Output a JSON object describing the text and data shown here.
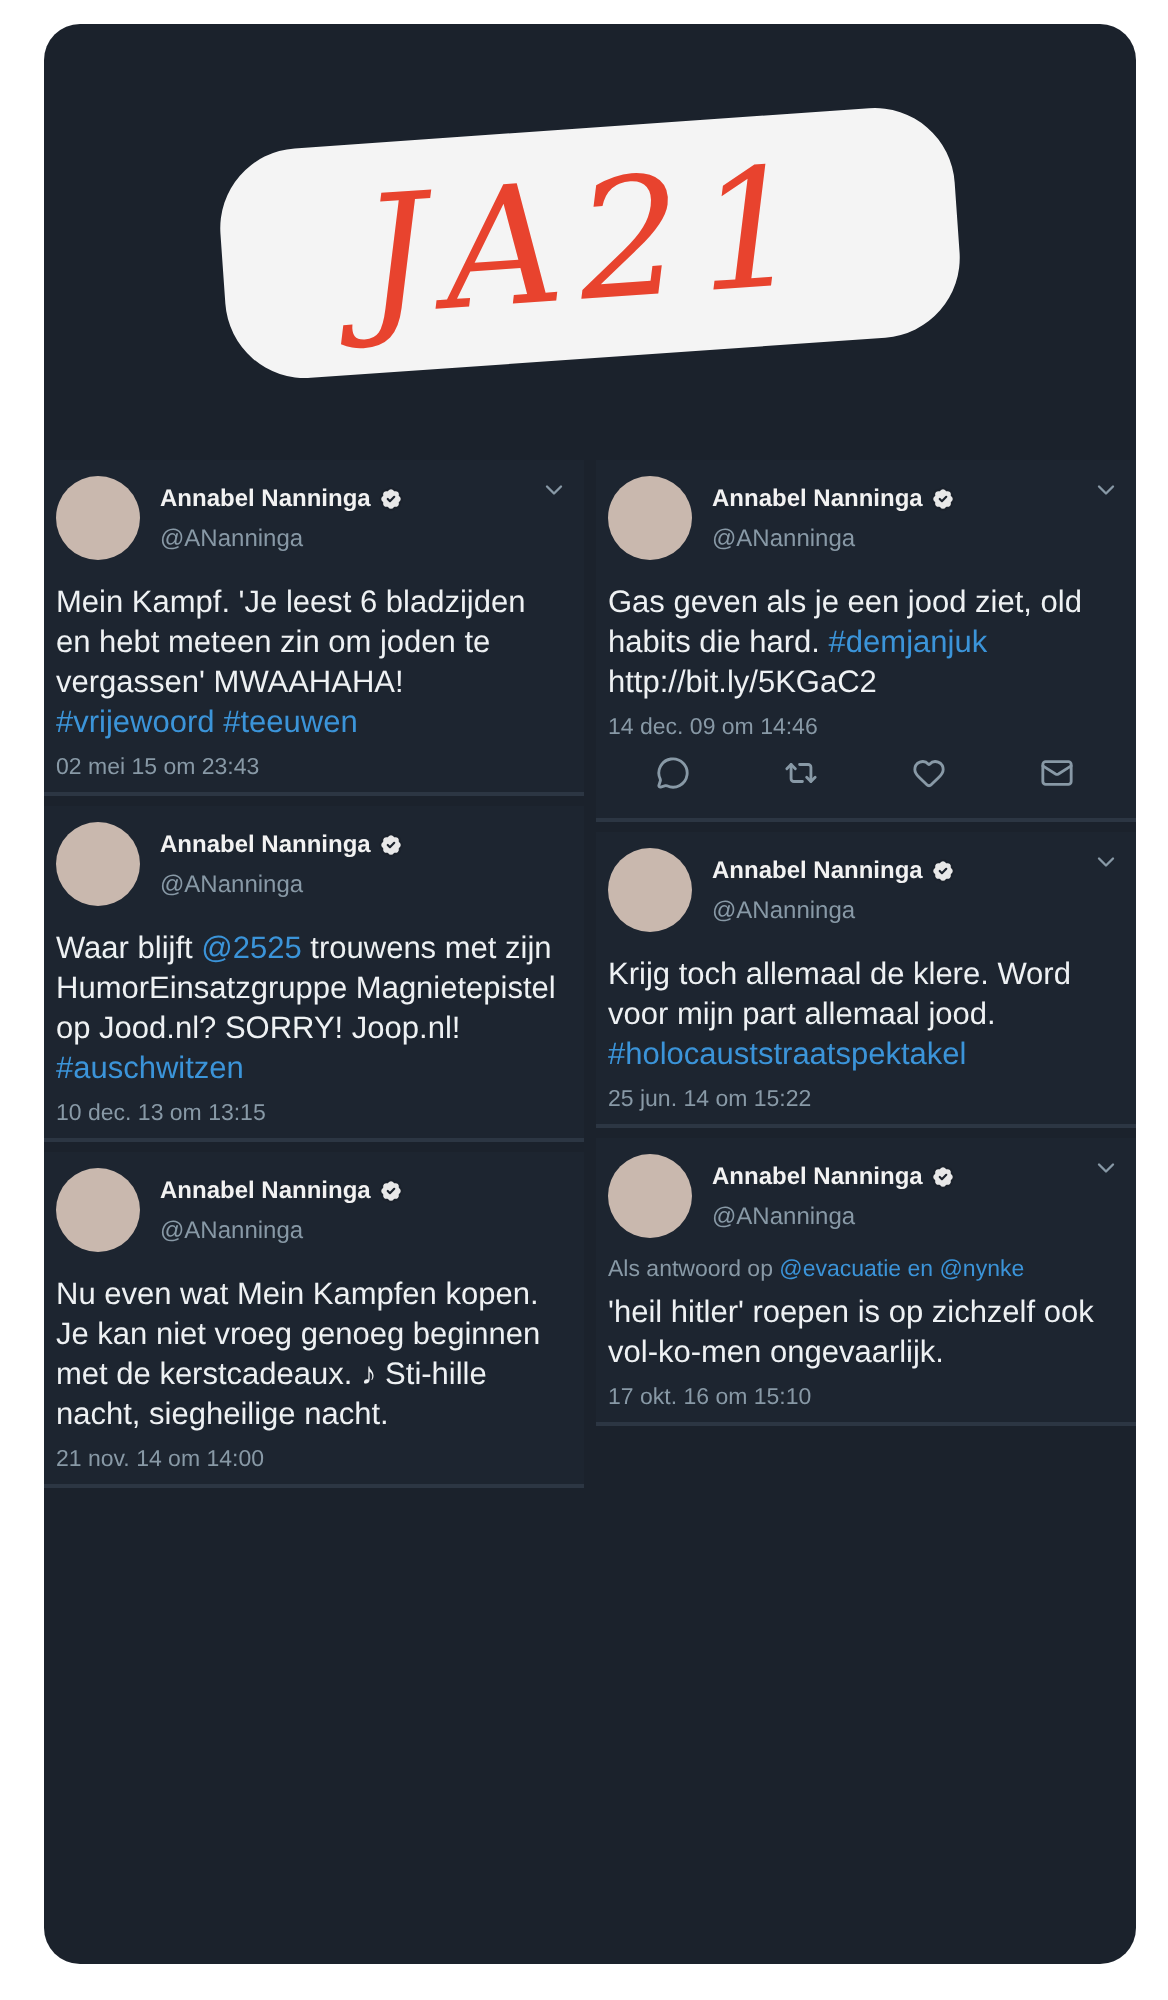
{
  "scribble": {
    "text": "JA21"
  },
  "columns": [
    {
      "tweets": [
        {
          "name": "Annabel Nanninga",
          "handle": "@ANanninga",
          "caret": true,
          "body": [
            {
              "kind": "text",
              "text": "Mein Kampf. 'Je leest 6 bladzijden en hebt meteen zin om joden te vergassen' MWAAHAHA! "
            },
            {
              "kind": "link",
              "text": "#vrijewoord"
            },
            {
              "kind": "link",
              "text": "#teeuwen"
            }
          ],
          "time": "02 mei 15 om 23:43"
        },
        {
          "name": "Annabel Nanninga",
          "handle": "@ANanninga",
          "caret": false,
          "body": [
            {
              "kind": "text",
              "text": "Waar blijft "
            },
            {
              "kind": "link",
              "text": "@2525"
            },
            {
              "kind": "text",
              "text": " trouwens met zijn HumorEinsatzgruppe Magnietepistel op Jood.nl? SORRY! Joop.nl! "
            },
            {
              "kind": "link",
              "text": "#auschwitzen"
            }
          ],
          "time": "10 dec. 13 om 13:15"
        },
        {
          "name": "Annabel Nanninga",
          "handle": "@ANanninga",
          "caret": false,
          "body": [
            {
              "kind": "text",
              "text": "Nu even wat Mein Kampfen kopen. Je kan niet vroeg genoeg beginnen met de kerstcadeaux. ♪ Sti-hille nacht, siegheilige nacht."
            }
          ],
          "time": "21 nov. 14 om 14:00"
        }
      ]
    },
    {
      "tweets": [
        {
          "name": "Annabel Nanninga",
          "handle": "@ANanninga",
          "caret": true,
          "body": [
            {
              "kind": "text",
              "text": "Gas geven als je een jood ziet, old habits die hard. "
            },
            {
              "kind": "link",
              "text": "#demjanjuk"
            },
            {
              "kind": "text",
              "text": " http://bit.ly/5KGaC2"
            }
          ],
          "time": "14 dec. 09 om 14:46",
          "action_bar": true
        },
        {
          "name": "Annabel Nanninga",
          "handle": "@ANanninga",
          "caret": true,
          "body": [
            {
              "kind": "text",
              "text": "Krijg toch allemaal de klere. Word voor mijn part allemaal jood. "
            },
            {
              "kind": "link",
              "text": "#holocauststraatspektakel"
            }
          ],
          "time": "25 jun. 14 om 15:22"
        },
        {
          "name": "Annabel Nanninga",
          "handle": "@ANanninga",
          "caret": true,
          "reply_to": [
            {
              "kind": "text",
              "text": "Als antwoord op "
            },
            {
              "kind": "link",
              "text": "@evacuatie en @nynke"
            }
          ],
          "body": [
            {
              "kind": "text",
              "text": "'heil hitler' roepen is op zichzelf ook vol-ko-men ongevaarlijk."
            }
          ],
          "time": "17 okt. 16 om 15:10"
        }
      ]
    }
  ]
}
